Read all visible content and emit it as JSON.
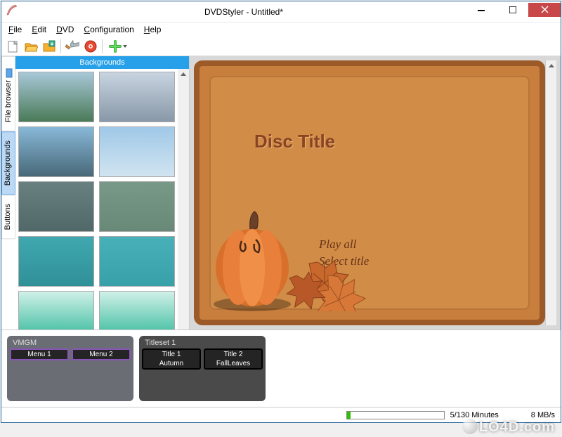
{
  "window": {
    "title": "DVDStyler - Untitled*"
  },
  "menubar": {
    "file": "File",
    "edit": "Edit",
    "dvd": "DVD",
    "configuration": "Configuration",
    "help": "Help"
  },
  "toolbar": {
    "new": "new-project",
    "open": "open-project",
    "save": "save-project",
    "settings": "settings",
    "burn": "burn-disc",
    "add": "add-item"
  },
  "side_tabs": {
    "file_browser": "File browser",
    "backgrounds": "Backgrounds",
    "buttons": "Buttons"
  },
  "panel": {
    "header": "Backgrounds"
  },
  "backgrounds": [
    {
      "name": "bg-island",
      "colors": [
        "#a8c8d8",
        "#4a7a58"
      ]
    },
    {
      "name": "bg-ship",
      "colors": [
        "#c8d4e0",
        "#8898a8"
      ]
    },
    {
      "name": "bg-coast",
      "colors": [
        "#88b8d8",
        "#486878"
      ]
    },
    {
      "name": "bg-sky",
      "colors": [
        "#a0c8e8",
        "#d0e4f0"
      ]
    },
    {
      "name": "bg-cloud-dark",
      "colors": [
        "#688080",
        "#506868"
      ]
    },
    {
      "name": "bg-cloud-green",
      "colors": [
        "#789888",
        "#688878"
      ]
    },
    {
      "name": "bg-teal-stripes",
      "colors": [
        "#40a8b0",
        "#309098"
      ]
    },
    {
      "name": "bg-teal-solid",
      "colors": [
        "#48b0b8",
        "#38a0a8"
      ]
    },
    {
      "name": "bg-mint-frame",
      "colors": [
        "#d0f0e8",
        "#30b898"
      ]
    },
    {
      "name": "bg-mint-frame2",
      "colors": [
        "#d0f0e8",
        "#30b898"
      ]
    }
  ],
  "preview": {
    "disc_title": "Disc Title",
    "play_all": "Play all",
    "select_title": "Select title"
  },
  "timeline": {
    "vmgm": {
      "label": "VMGM",
      "items": [
        {
          "label": "Menu 1"
        },
        {
          "label": "Menu 2"
        }
      ]
    },
    "titleset1": {
      "label": "Titleset 1",
      "items": [
        {
          "label": "Title 1",
          "footer": "Autumn"
        },
        {
          "label": "Title 2",
          "footer": "FallLeaves"
        }
      ]
    }
  },
  "status": {
    "minutes": "5/130 Minutes",
    "bitrate": "8 MB/s",
    "progress_pct": 4
  },
  "watermark": "LO4D.com"
}
